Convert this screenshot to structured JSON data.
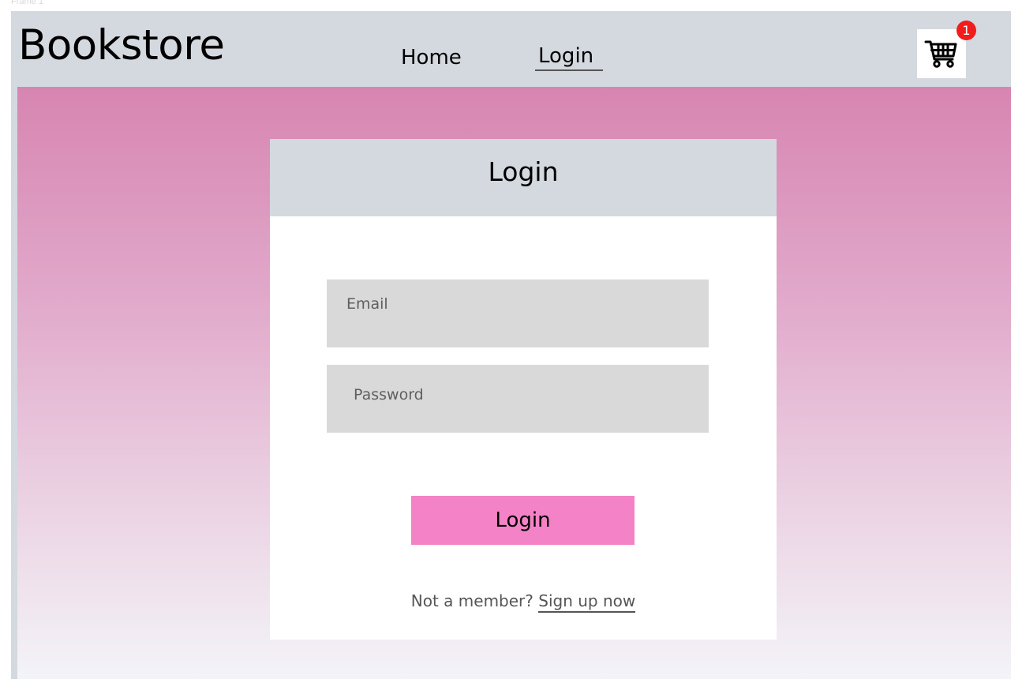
{
  "frame_label": "Frame 1",
  "header": {
    "brand": "Bookstore",
    "nav": {
      "home_label": "Home",
      "login_label": "Login"
    },
    "cart": {
      "icon": "cart-icon",
      "badge_count": "1"
    }
  },
  "login_card": {
    "title": "Login",
    "email_placeholder": "Email",
    "password_placeholder": "Password",
    "submit_label": "Login",
    "signup_prompt": "Not a member?",
    "signup_link": "Sign up now"
  },
  "colors": {
    "header_bg": "#d4d9e0",
    "button_pink": "#f383c6",
    "badge_red": "#f21c1c",
    "gradient_top": "#d785b1",
    "gradient_bottom": "#f3f4f8"
  }
}
